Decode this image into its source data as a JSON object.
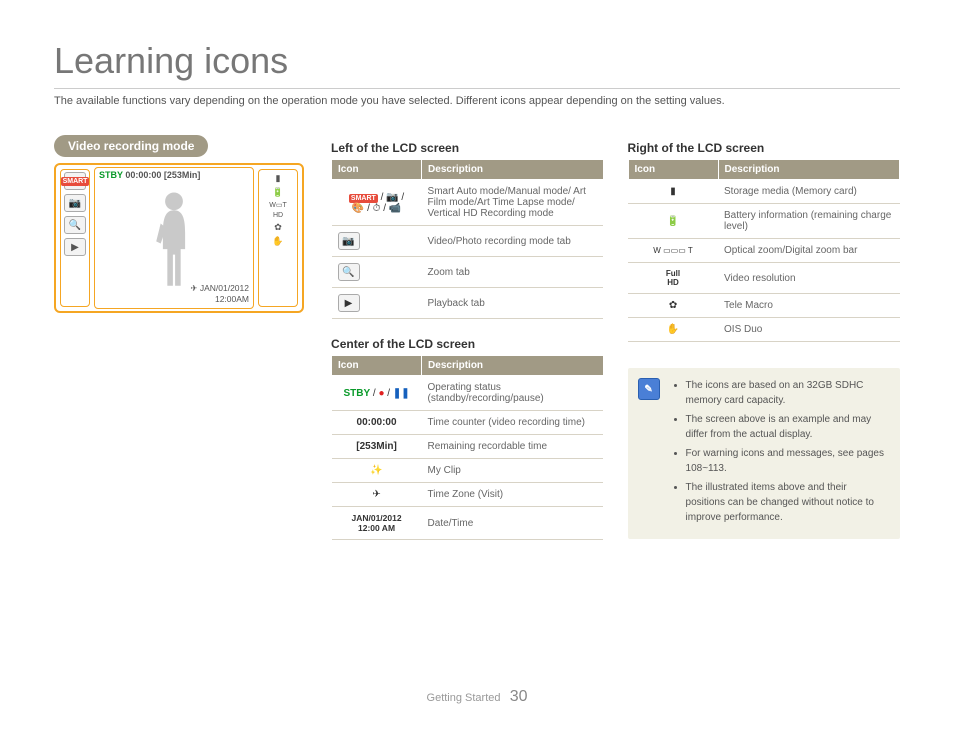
{
  "page": {
    "title": "Learning icons",
    "intro": "The available functions vary depending on the operation mode you have selected. Different icons appear depending on the setting values.",
    "section_footer": "Getting Started",
    "page_number": "30"
  },
  "badge": "Video recording mode",
  "lcd": {
    "stby": "STBY",
    "time": "00:00:00",
    "remaining": "[253Min]",
    "date": "JAN/01/2012",
    "clock": "12:00AM"
  },
  "tables": {
    "icon_header": "Icon",
    "desc_header": "Description",
    "left": {
      "heading": "Left of the LCD screen",
      "rows": [
        {
          "icon": "modes",
          "desc": "Smart Auto mode/Manual mode/\nArt Film mode/Art Time Lapse mode/\nVertical HD Recording mode"
        },
        {
          "icon": "rec-tab",
          "desc": "Video/Photo recording mode tab"
        },
        {
          "icon": "zoom-tab",
          "desc": "Zoom tab"
        },
        {
          "icon": "playback-tab",
          "desc": "Playback tab"
        }
      ]
    },
    "center": {
      "heading": "Center of the LCD screen",
      "rows": [
        {
          "icon": "stby-rec",
          "desc": "Operating status (standby/recording/pause)"
        },
        {
          "icon": "00:00:00",
          "desc": "Time counter (video recording time)"
        },
        {
          "icon": "[253Min]",
          "desc": "Remaining recordable time"
        },
        {
          "icon": "myclip",
          "desc": "My Clip"
        },
        {
          "icon": "timezone",
          "desc": "Time Zone (Visit)"
        },
        {
          "icon": "JAN/01/2012\n12:00 AM",
          "desc": "Date/Time"
        }
      ]
    },
    "right": {
      "heading": "Right of the LCD screen",
      "rows": [
        {
          "icon": "card",
          "desc": "Storage media (Memory card)"
        },
        {
          "icon": "battery",
          "desc": "Battery information (remaining charge level)"
        },
        {
          "icon": "zoom-bar",
          "desc": "Optical zoom/Digital zoom bar"
        },
        {
          "icon": "resolution",
          "desc": "Video resolution"
        },
        {
          "icon": "telemacro",
          "desc": "Tele Macro"
        },
        {
          "icon": "ois",
          "desc": "OIS Duo"
        }
      ]
    }
  },
  "notes": {
    "items": [
      "The icons are based on an 32GB SDHC memory card capacity.",
      "The screen above is an example and may differ from the actual display.",
      "For warning icons and messages, see pages 108~113.",
      "The illustrated items above and their positions can be changed without notice to improve performance."
    ]
  }
}
